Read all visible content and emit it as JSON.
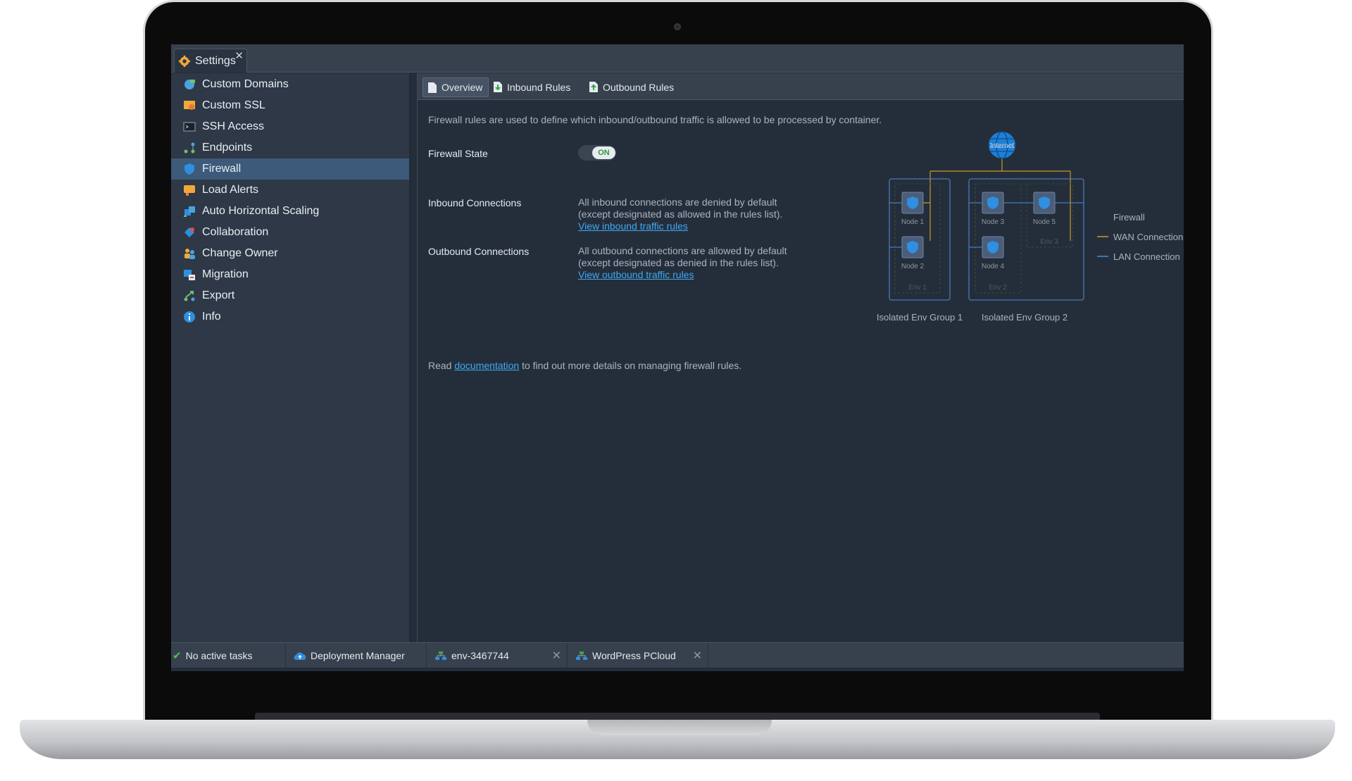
{
  "header": {
    "settings_tab_label": "Settings",
    "close_glyph": "✕"
  },
  "sidebar": {
    "items": [
      {
        "label": "Custom Domains",
        "icon": "globe-domains-icon"
      },
      {
        "label": "Custom SSL",
        "icon": "certificate-icon"
      },
      {
        "label": "SSH Access",
        "icon": "terminal-icon"
      },
      {
        "label": "Endpoints",
        "icon": "endpoints-icon"
      },
      {
        "label": "Firewall",
        "icon": "shield-icon",
        "active": true
      },
      {
        "label": "Load Alerts",
        "icon": "alert-icon"
      },
      {
        "label": "Auto Horizontal Scaling",
        "icon": "scaling-icon"
      },
      {
        "label": "Collaboration",
        "icon": "collaboration-icon"
      },
      {
        "label": "Change Owner",
        "icon": "users-icon"
      },
      {
        "label": "Migration",
        "icon": "migration-icon"
      },
      {
        "label": "Export",
        "icon": "export-icon"
      },
      {
        "label": "Info",
        "icon": "info-icon"
      }
    ]
  },
  "subtabs": {
    "overview": "Overview",
    "inbound": "Inbound Rules",
    "outbound": "Outbound Rules"
  },
  "content": {
    "intro": "Firewall rules are used to define which inbound/outbound traffic is allowed to be processed by container.",
    "firewall_state_label": "Firewall State",
    "toggle_label": "ON",
    "inbound_label": "Inbound Connections",
    "inbound_line1": "All inbound connections are denied by default",
    "inbound_line2": "(except designated as allowed in the rules list).",
    "inbound_link": "View inbound traffic rules",
    "outbound_label": "Outbound Connections",
    "outbound_line1": "All outbound connections are allowed by default",
    "outbound_line2": "(except designated as denied in the rules list).",
    "outbound_link": "View outbound traffic rules",
    "doc_prefix": "Read",
    "doc_link": "documentation",
    "doc_suffix": "to find out more details on managing firewall rules."
  },
  "diagram": {
    "internet": "Internet",
    "nodes": [
      "Node 1",
      "Node 2",
      "Node 3",
      "Node 4",
      "Node 5"
    ],
    "envs": [
      "Env 1",
      "Env 2",
      "Env 3"
    ],
    "groups": [
      "Isolated Env Group 1",
      "Isolated Env Group 2"
    ],
    "legend": {
      "firewall": "Firewall",
      "wan": "WAN Connection",
      "lan": "LAN Connection"
    },
    "colors": {
      "wan": "#c99a2e",
      "lan": "#4a90d9",
      "frame": "#4a78b8"
    }
  },
  "taskbar": {
    "tasks_status": "No active tasks",
    "deployment_manager": "Deployment Manager",
    "env1": "env-3467744",
    "env2": "WordPress PCloud"
  }
}
